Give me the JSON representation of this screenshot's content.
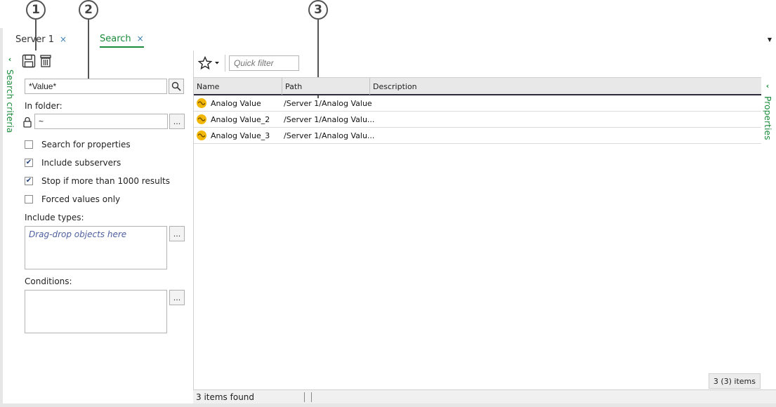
{
  "callouts": [
    "1",
    "2",
    "3"
  ],
  "tabs": [
    {
      "label": "Server 1",
      "close": "×"
    },
    {
      "label": "Search",
      "close": "×"
    }
  ],
  "tab_menu": "▼",
  "sidebars": {
    "left_label": "Search criteria",
    "right_label": "Properties",
    "chevron": "‹"
  },
  "criteria": {
    "icons": [
      "save-icon",
      "delete-icon",
      "search-icon",
      "lock-icon"
    ],
    "search_value": "*Value*",
    "in_folder_label": "In folder:",
    "folder_value": "~",
    "browse_label": "...",
    "checkboxes": [
      {
        "label": "Search for properties",
        "checked": false
      },
      {
        "label": "Include subservers",
        "checked": true
      },
      {
        "label": "Stop if more than 1000 results",
        "checked": true
      },
      {
        "label": "Forced values only",
        "checked": false
      }
    ],
    "check_mark": "✔",
    "include_types_label": "Include types:",
    "include_types_placeholder": "Drag-drop objects here",
    "conditions_label": "Conditions:"
  },
  "results": {
    "toolbar_icons": [
      "favorites-star-icon",
      "dropdown-arrow-icon"
    ],
    "quick_filter_placeholder": "Quick filter",
    "columns": [
      "Name",
      "Path",
      "Description"
    ],
    "rows": [
      {
        "name": "Analog Value",
        "path": "/Server 1/Analog Value",
        "description": ""
      },
      {
        "name": "Analog Value_2",
        "path": "/Server 1/Analog Valu...",
        "description": ""
      },
      {
        "name": "Analog Value_3",
        "path": "/Server 1/Analog Valu...",
        "description": ""
      }
    ],
    "item_count": "3 (3) items",
    "status": "3 items found"
  },
  "colors": {
    "accent_green": "#1a8b3a",
    "close_blue": "#3a7fb3",
    "analog_icon": "#f2b705"
  }
}
